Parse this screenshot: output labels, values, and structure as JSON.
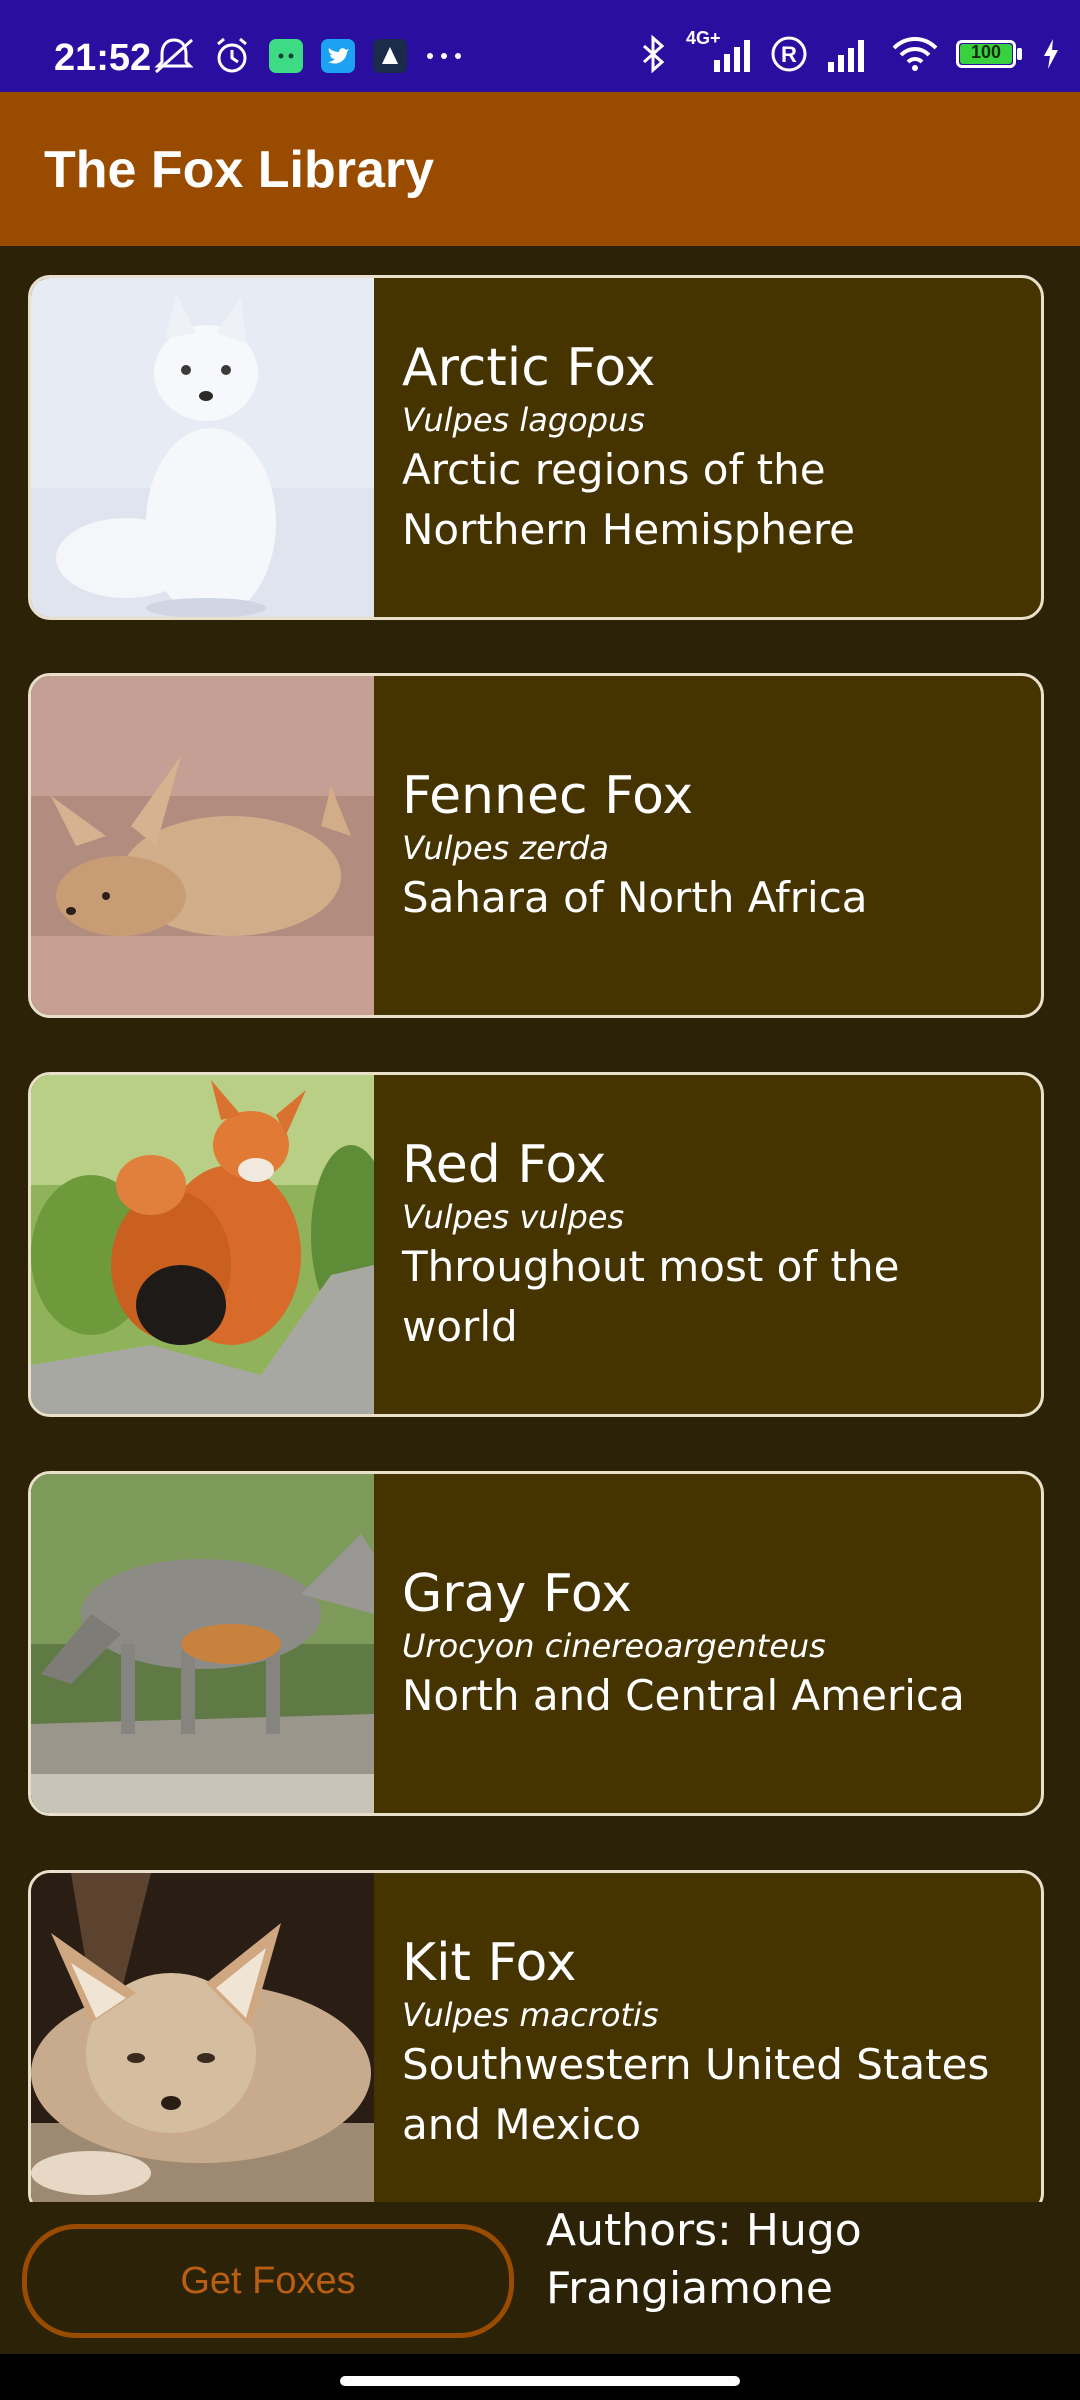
{
  "status_bar": {
    "time": "21:52",
    "left_icons": [
      "mute-alarm-icon",
      "alarm-clock-icon",
      "android-app-icon",
      "twitter-icon",
      "app-icon",
      "more-dots-icon"
    ],
    "network_label": "4G+",
    "battery_level": "100",
    "right_icons": [
      "bluetooth-icon",
      "cell-signal-icon",
      "roaming-r-icon",
      "cell-signal-icon",
      "wifi-icon",
      "battery-icon",
      "charging-icon"
    ]
  },
  "app_bar": {
    "title": "The Fox Library",
    "color": "#994c00"
  },
  "foxes": [
    {
      "name": "Arctic Fox",
      "scientific": "Vulpes lagopus",
      "region": "Arctic regions of the Northern Hemisphere",
      "image": "arctic-fox-photo"
    },
    {
      "name": "Fennec Fox",
      "scientific": "Vulpes zerda",
      "region": "Sahara of North Africa",
      "image": "fennec-fox-photo"
    },
    {
      "name": "Red Fox",
      "scientific": "Vulpes vulpes",
      "region": "Throughout most of the world",
      "image": "red-fox-photo"
    },
    {
      "name": "Gray Fox",
      "scientific": "Urocyon cinereoargenteus",
      "region": "North and Central America",
      "image": "gray-fox-photo"
    },
    {
      "name": "Kit Fox",
      "scientific": "Vulpes macrotis",
      "region": "Southwestern United States and Mexico",
      "image": "kit-fox-photo"
    }
  ],
  "bottom": {
    "button_label": "Get Foxes",
    "authors": "Authors: Hugo Frangiamone"
  },
  "colors": {
    "status_bar": "#2a0ea0",
    "app_bar": "#994c00",
    "background": "#2c2208",
    "card": "#453300",
    "card_border": "#e9e0cc",
    "button_text": "#b85f14"
  }
}
